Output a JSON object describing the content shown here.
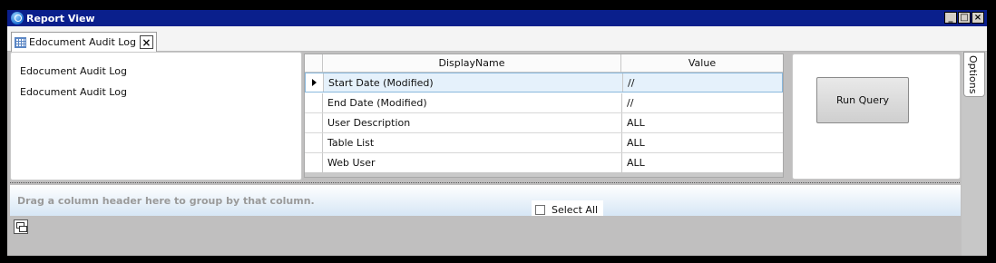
{
  "window": {
    "title": "Report View",
    "buttons": {
      "minimize": "_",
      "maximize": "□",
      "close": "×"
    }
  },
  "tabs": [
    {
      "label": "Edocument Audit Log",
      "close": "×"
    }
  ],
  "left_panel": {
    "lines": [
      "Edocument Audit Log",
      "Edocument Audit Log"
    ]
  },
  "parameters": {
    "columns": [
      "DisplayName",
      "Value"
    ],
    "rows": [
      {
        "name": "Start Date (Modified)",
        "value": "//",
        "selected": true
      },
      {
        "name": "End Date (Modified)",
        "value": "//"
      },
      {
        "name": "User Description",
        "value": "ALL"
      },
      {
        "name": "Table List",
        "value": "ALL"
      },
      {
        "name": "Web User",
        "value": "ALL"
      }
    ]
  },
  "run_query": {
    "label": "Run Query"
  },
  "options": {
    "label": "Options"
  },
  "group_bar": {
    "hint": "Drag a column header here to group by that column."
  },
  "select_all": {
    "label": "Select All",
    "checked": false
  },
  "colors": {
    "title_bar": "#0a1f8c",
    "selected_row": "#e5f1fb",
    "group_bar": "#d6e6f5",
    "content_background": "#c0bfbf"
  }
}
